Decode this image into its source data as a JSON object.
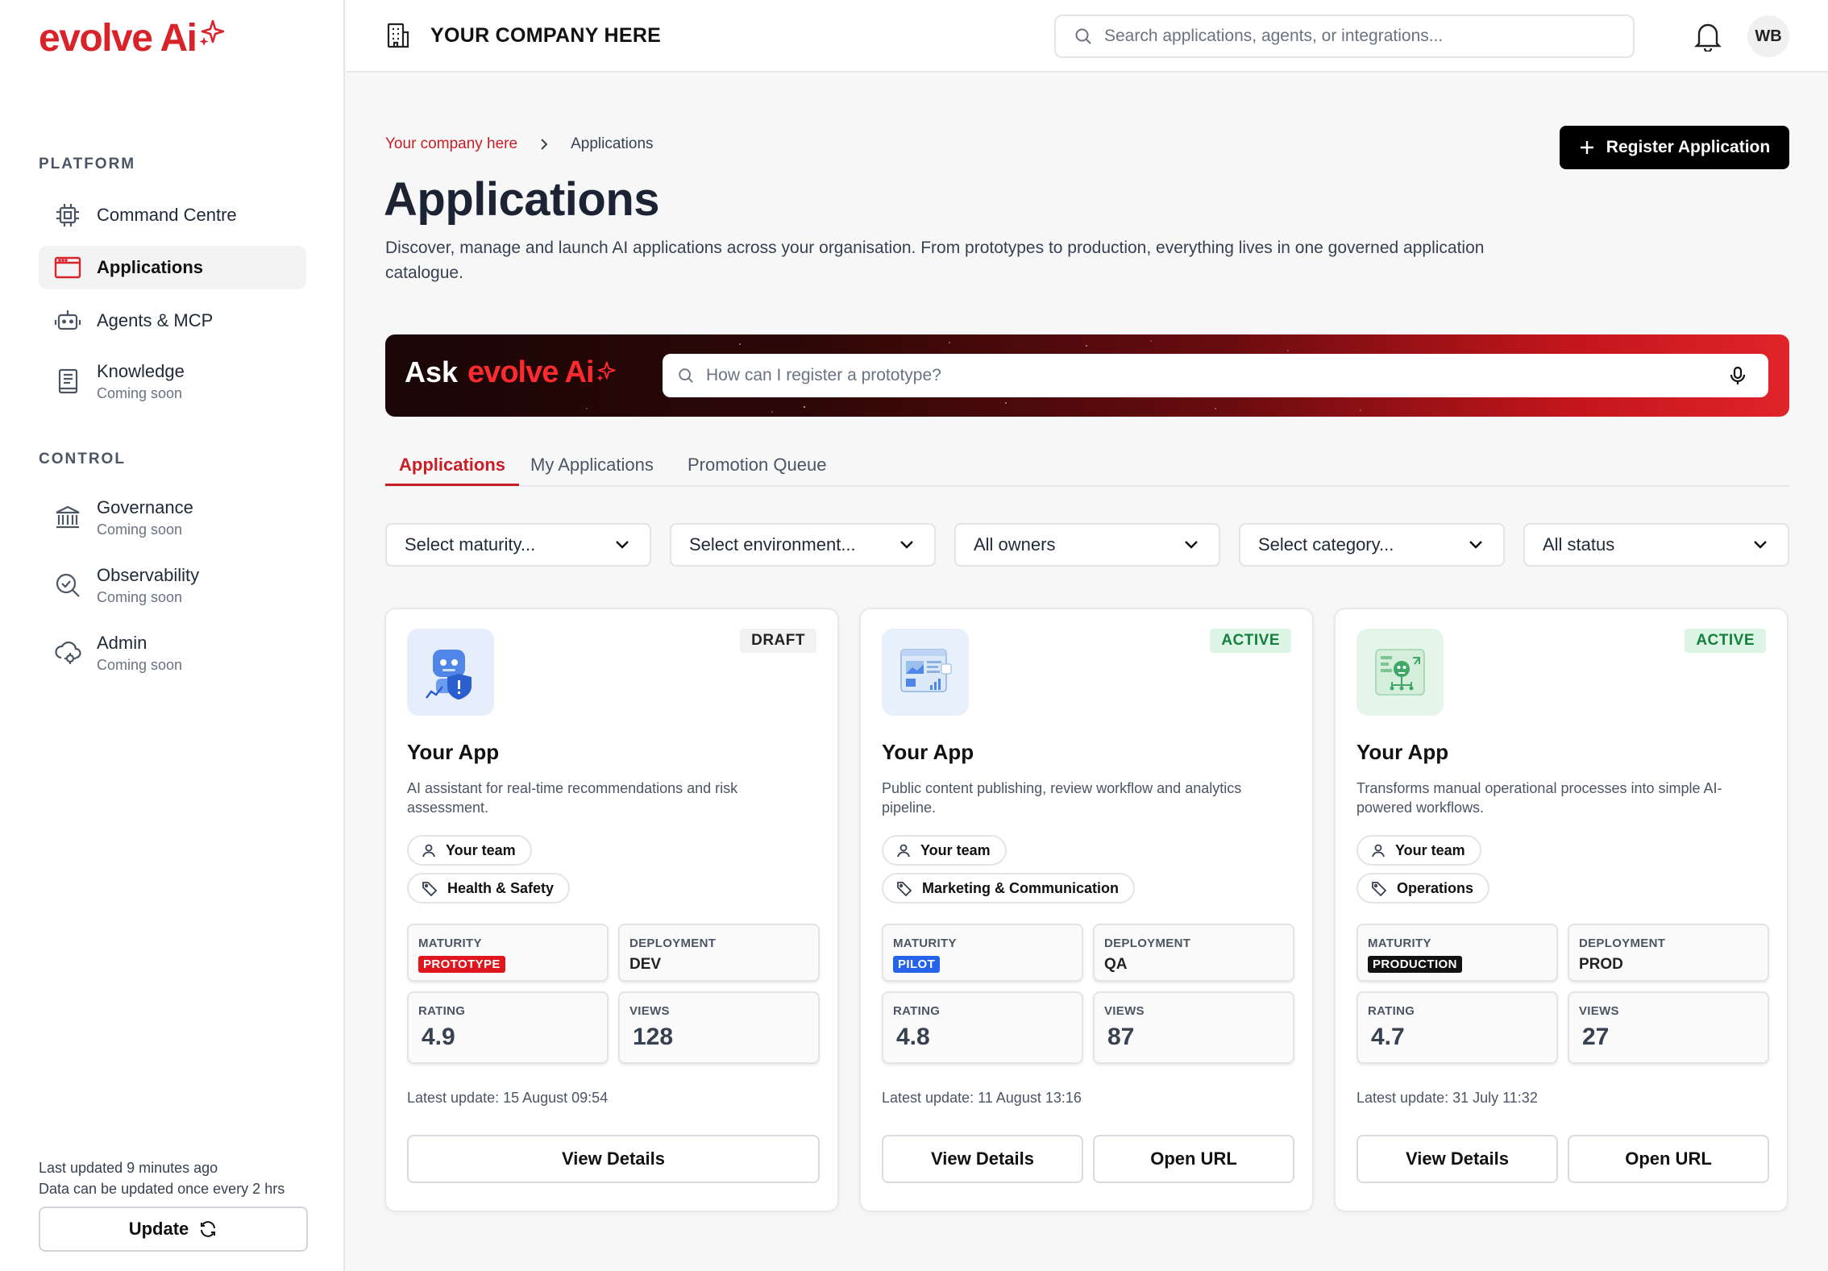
{
  "brand": {
    "logo_text": "evolve Ai",
    "accent": "#d8232a"
  },
  "sidebar": {
    "sections": [
      {
        "label": "PLATFORM"
      },
      {
        "label": "CONTROL"
      }
    ],
    "items": [
      {
        "label": "Command Centre",
        "sub": "",
        "icon": "chip-icon"
      },
      {
        "label": "Applications",
        "sub": "",
        "icon": "window-icon",
        "active": true
      },
      {
        "label": "Agents & MCP",
        "sub": "",
        "icon": "robot-icon"
      },
      {
        "label": "Knowledge",
        "sub": "Coming soon",
        "icon": "book-icon"
      },
      {
        "label": "Governance",
        "sub": "Coming soon",
        "icon": "bank-icon"
      },
      {
        "label": "Observability",
        "sub": "Coming soon",
        "icon": "search-check-icon"
      },
      {
        "label": "Admin",
        "sub": "Coming soon",
        "icon": "cloud-gear-icon"
      }
    ],
    "footer": {
      "last_updated": "Last updated 9 minutes ago",
      "note": "Data can be updated once every 2 hrs",
      "update_label": "Update"
    }
  },
  "topbar": {
    "company": "YOUR COMPANY HERE",
    "search_placeholder": "Search applications, agents, or integrations...",
    "avatar": "WB"
  },
  "breadcrumb": {
    "root": "Your company here",
    "current": "Applications"
  },
  "page": {
    "title": "Applications",
    "description": "Discover, manage and launch AI applications across your organisation. From prototypes to production, everything lives in one governed application catalogue.",
    "register_label": "Register Application"
  },
  "ask": {
    "prefix": "Ask",
    "brand": "evolve Ai",
    "placeholder": "How can I register a prototype?"
  },
  "tabs": [
    {
      "label": "Applications",
      "active": true
    },
    {
      "label": "My Applications"
    },
    {
      "label": "Promotion Queue"
    }
  ],
  "filters": [
    "Select maturity...",
    "Select environment...",
    "All owners",
    "Select category...",
    "All status"
  ],
  "cards": [
    {
      "status": "DRAFT",
      "name": "Your App",
      "description": "AI assistant for real-time recommendations and risk assessment.",
      "team": "Your team",
      "category": "Health & Safety",
      "maturity_label": "MATURITY",
      "maturity": "PROTOTYPE",
      "maturity_color": "#e0161e",
      "deployment_label": "DEPLOYMENT",
      "deployment": "DEV",
      "rating_label": "RATING",
      "rating": "4.9",
      "views_label": "VIEWS",
      "views": "128",
      "latest": "Latest update: 15 August 09:54",
      "view_details": "View Details"
    },
    {
      "status": "ACTIVE",
      "name": "Your App",
      "description": "Public content publishing, review workflow and analytics pipeline.",
      "team": "Your team",
      "category": "Marketing & Communication",
      "maturity_label": "MATURITY",
      "maturity": "PILOT",
      "maturity_color": "#2563eb",
      "deployment_label": "DEPLOYMENT",
      "deployment": "QA",
      "rating_label": "RATING",
      "rating": "4.8",
      "views_label": "VIEWS",
      "views": "87",
      "latest": "Latest update: 11 August 13:16",
      "view_details": "View Details",
      "open_url": "Open URL"
    },
    {
      "status": "ACTIVE",
      "name": "Your App",
      "description": "Transforms manual operational processes into simple AI-powered workflows.",
      "team": "Your team",
      "category": "Operations",
      "maturity_label": "MATURITY",
      "maturity": "PRODUCTION",
      "maturity_color": "#111111",
      "deployment_label": "DEPLOYMENT",
      "deployment": "PROD",
      "rating_label": "RATING",
      "rating": "4.7",
      "views_label": "VIEWS",
      "views": "27",
      "latest": "Latest update: 31 July 11:32",
      "view_details": "View Details",
      "open_url": "Open URL"
    }
  ]
}
